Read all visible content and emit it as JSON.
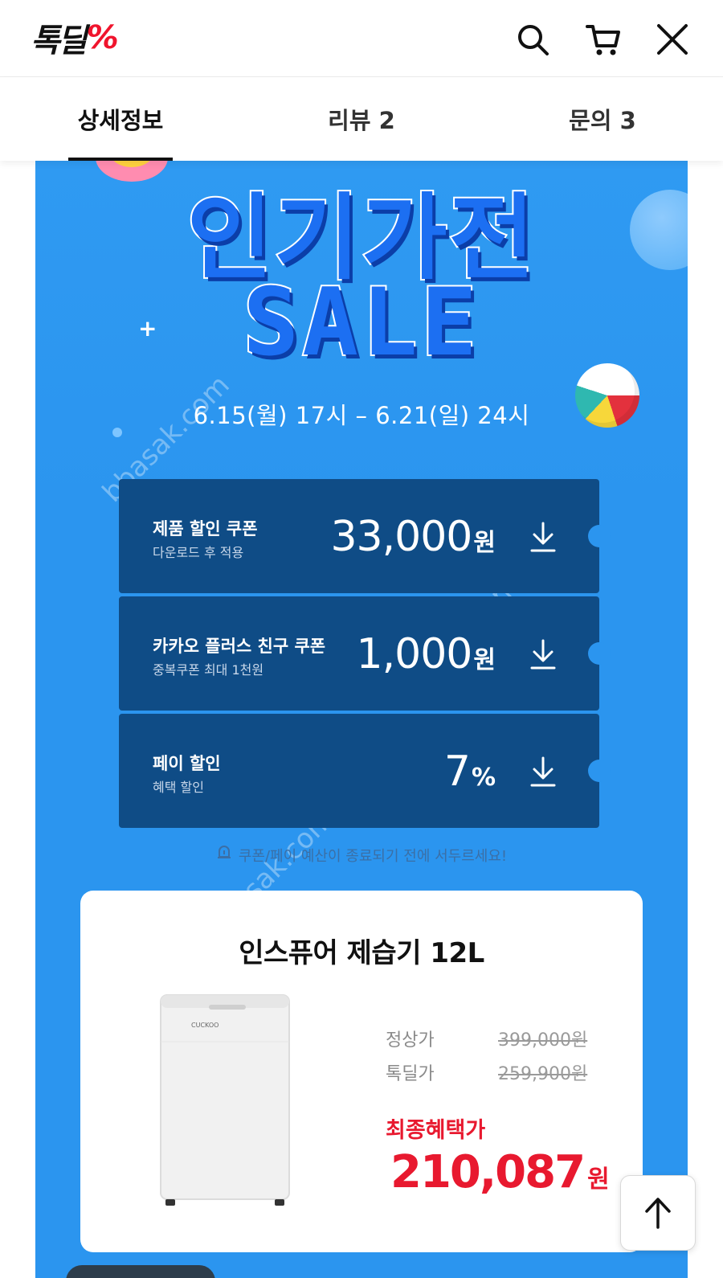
{
  "header": {
    "logo_text": "톡딜",
    "logo_mark": "%",
    "icons": [
      "search-icon",
      "cart-icon",
      "close-icon"
    ]
  },
  "tabs": [
    {
      "label": "상세정보",
      "active": true
    },
    {
      "label": "리뷰 2",
      "active": false
    },
    {
      "label": "문의 3",
      "active": false
    }
  ],
  "banner": {
    "title_line1": "인기가전",
    "title_line2": "SALE",
    "dates": "6.15(월) 17시 – 6.21(일) 24시",
    "watermark": "bbasak.com",
    "bg_color": "#2b95ef",
    "coupon_color": "#0f4c86"
  },
  "coupons": [
    {
      "title": "제품 할인 쿠폰",
      "sub": "다운로드 후 적용",
      "amount": "33,000",
      "unit": "원"
    },
    {
      "title": "카카오 플러스 친구 쿠폰",
      "sub": "중복쿠폰 최대 1천원",
      "amount": "1,000",
      "unit": "원"
    },
    {
      "title": "페이 할인",
      "sub": "혜택 할인",
      "amount": "7",
      "unit": "%"
    }
  ],
  "notice": "쿠폰/페이 예산이 종료되기 전에 서두르세요!",
  "product": {
    "name": "인스퓨어 제습기 12L",
    "brand_on_image": "CUCKOO",
    "regular_label": "정상가",
    "regular_price": "399,000원",
    "deal_label": "톡딜가",
    "deal_price": "259,900원",
    "final_label": "최종혜택가",
    "final_price": "210,087",
    "final_unit": "원",
    "accent_color": "#e8192f"
  }
}
